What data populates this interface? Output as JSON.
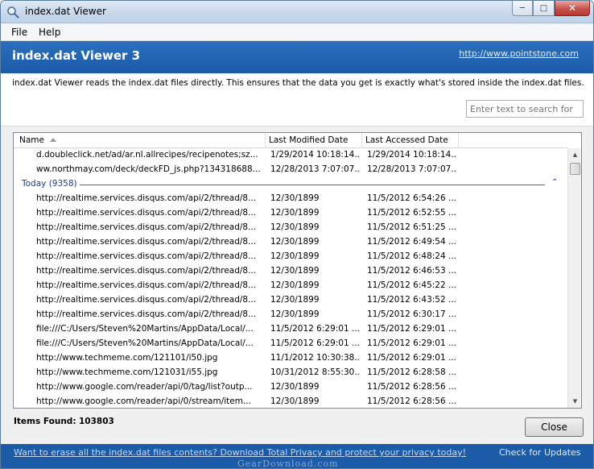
{
  "window": {
    "title": "index.dat Viewer",
    "minimize": "─",
    "maximize": "□",
    "close": "✕"
  },
  "menu": {
    "file": "File",
    "help": "Help"
  },
  "banner": {
    "heading": "index.dat Viewer 3",
    "link": "http://www.pointstone.com"
  },
  "description": "index.dat Viewer reads the index.dat files directly. This ensures that the data you get is exactly what's stored inside the index.dat files.",
  "search": {
    "placeholder": "Enter text to search for"
  },
  "columns": {
    "name": "Name",
    "modified": "Last Modified Date",
    "accessed": "Last Accessed Date"
  },
  "rows_before": [
    {
      "name": "d.doubleclick.net/ad/ar.nl.allrecipes/recipenotes;sz...",
      "modified": "1/29/2014 10:18:14...",
      "accessed": "1/29/2014 10:18:14..."
    },
    {
      "name": "ww.northmay.com/deck/deckFD_js.php?134318688...",
      "modified": "12/28/2013 7:07:07...",
      "accessed": "12/28/2013 7:07:07..."
    }
  ],
  "group": {
    "label": "Today (9358)",
    "chevron": "⌃"
  },
  "rows": [
    {
      "name": "http://realtime.services.disqus.com/api/2/thread/8...",
      "modified": "12/30/1899",
      "accessed": "11/5/2012 6:54:26 ..."
    },
    {
      "name": "http://realtime.services.disqus.com/api/2/thread/8...",
      "modified": "12/30/1899",
      "accessed": "11/5/2012 6:52:55 ..."
    },
    {
      "name": "http://realtime.services.disqus.com/api/2/thread/8...",
      "modified": "12/30/1899",
      "accessed": "11/5/2012 6:51:25 ..."
    },
    {
      "name": "http://realtime.services.disqus.com/api/2/thread/8...",
      "modified": "12/30/1899",
      "accessed": "11/5/2012 6:49:54 ..."
    },
    {
      "name": "http://realtime.services.disqus.com/api/2/thread/8...",
      "modified": "12/30/1899",
      "accessed": "11/5/2012 6:48:24 ..."
    },
    {
      "name": "http://realtime.services.disqus.com/api/2/thread/8...",
      "modified": "12/30/1899",
      "accessed": "11/5/2012 6:46:53 ..."
    },
    {
      "name": "http://realtime.services.disqus.com/api/2/thread/8...",
      "modified": "12/30/1899",
      "accessed": "11/5/2012 6:45:22 ..."
    },
    {
      "name": "http://realtime.services.disqus.com/api/2/thread/8...",
      "modified": "12/30/1899",
      "accessed": "11/5/2012 6:43:52 ..."
    },
    {
      "name": "http://realtime.services.disqus.com/api/2/thread/8...",
      "modified": "12/30/1899",
      "accessed": "11/5/2012 6:30:17 ..."
    },
    {
      "name": "file:///C:/Users/Steven%20Martins/AppData/Local/...",
      "modified": "11/5/2012 6:29:01 ...",
      "accessed": "11/5/2012 6:29:01 ..."
    },
    {
      "name": "file:///C:/Users/Steven%20Martins/AppData/Local/...",
      "modified": "11/5/2012 6:29:01 ...",
      "accessed": "11/5/2012 6:29:01 ..."
    },
    {
      "name": "http://www.techmeme.com/121101/i50.jpg",
      "modified": "11/1/2012 10:30:38...",
      "accessed": "11/5/2012 6:29:01 ..."
    },
    {
      "name": "http://www.techmeme.com/121031/i55.jpg",
      "modified": "10/31/2012 8:55:30...",
      "accessed": "11/5/2012 6:28:58 ..."
    },
    {
      "name": "http://www.google.com/reader/api/0/tag/list?outp...",
      "modified": "12/30/1899",
      "accessed": "11/5/2012 6:28:56 ..."
    },
    {
      "name": "http://www.google.com/reader/api/0/stream/item...",
      "modified": "12/30/1899",
      "accessed": "11/5/2012 6:28:56 ..."
    }
  ],
  "status": {
    "items_found_label": "Items Found:",
    "items_found_value": "103803"
  },
  "close_button": "Close",
  "footer": {
    "promo": "Want to erase all the index.dat files contents? Download Total Privacy and protect your privacy today!",
    "updates": "Check for Updates",
    "watermark": "GearDownload.com"
  },
  "colors": {
    "accent_blue": "#1c5ba8",
    "group_blue": "#1e3a8a"
  }
}
